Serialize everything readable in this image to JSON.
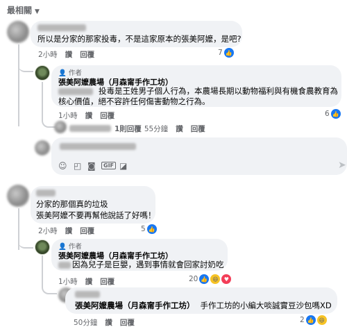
{
  "sort_label": "最相關",
  "comments": [
    {
      "id": "c1",
      "author": "",
      "text": "所以是分家的那家投毒，不是這家原本的張美阿嬤，是吧?",
      "time": "2小時",
      "like": "讚",
      "reply": "回覆",
      "reactions": "7"
    },
    {
      "id": "r1",
      "badge": "作者",
      "author": "張美阿嬤農場（月森甯手作工坊）",
      "text_line1": "投毒是王姓男子個人行為，本農場長期以動物福利與有機食農教育為",
      "text_line2": "核心價值，絕不容許任何傷害動物之行為。",
      "time": "1小時",
      "like": "讚",
      "reply": "回覆",
      "reactions": "6"
    },
    {
      "id": "r1-sub",
      "replies_summary": "1則回覆",
      "time": "55分鐘",
      "like": "讚",
      "reply": "回覆"
    },
    {
      "id": "c2",
      "text_line1": "分家的那個真的垃圾",
      "text_line2": "張美阿嬤不要再幫他說話了好嗎！",
      "time": "2小時",
      "like": "讚",
      "reply": "回覆",
      "reactions": "5"
    },
    {
      "id": "r2",
      "badge": "作者",
      "author": "張美阿嬤農場（月森甯手作工坊）",
      "text": "因為兒子是巨嬰，遇到事情就會回家討奶吃",
      "time": "1小時",
      "like": "讚",
      "reply": "回覆",
      "reactions": "20"
    },
    {
      "id": "r3",
      "mention": "張美阿嬤農場（月森甯手作工坊）",
      "text": "手作工坊的小編大啖誠實豆沙包嗎XD",
      "time": "50分鐘",
      "like": "讚",
      "reply": "回覆",
      "reactions": "2"
    }
  ],
  "reply_box": {
    "icons": [
      "smiley-icon",
      "sticker-icon",
      "camera-icon",
      "gif-icon",
      "emoji-sticker-icon"
    ],
    "send_icon": "send-icon"
  },
  "colors": {
    "link_blue": "#1877f2",
    "bubble_bg": "#f0f2f5",
    "meta_gray": "#65676b"
  }
}
